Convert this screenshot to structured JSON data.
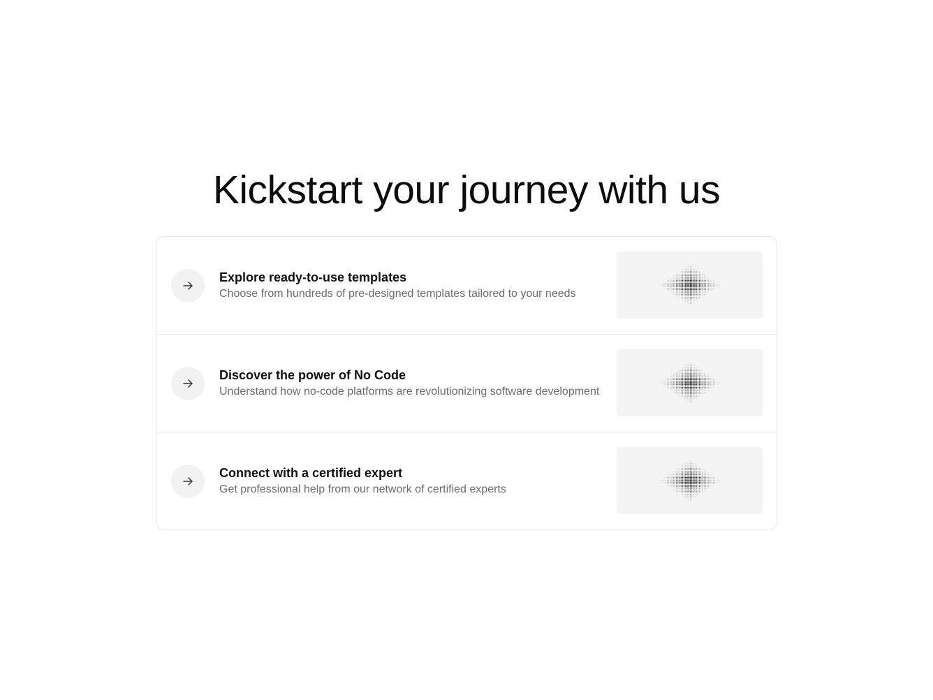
{
  "headline": "Kickstart your journey with us",
  "items": [
    {
      "title": "Explore ready-to-use templates",
      "description": "Choose from hundreds of pre-designed templates tailored to your needs",
      "icon": "arrow-right-icon"
    },
    {
      "title": "Discover the power of No Code",
      "description": "Understand how no-code platforms are revolutionizing software development",
      "icon": "arrow-right-icon"
    },
    {
      "title": "Connect with a certified expert",
      "description": "Get professional help from our network of certified experts",
      "icon": "arrow-right-icon"
    }
  ],
  "colors": {
    "text": "#111111",
    "muted": "#6b6b6b",
    "border": "#e6e6e6",
    "icon_bg": "#f2f2f2",
    "thumb_bg": "#f4f4f4"
  }
}
